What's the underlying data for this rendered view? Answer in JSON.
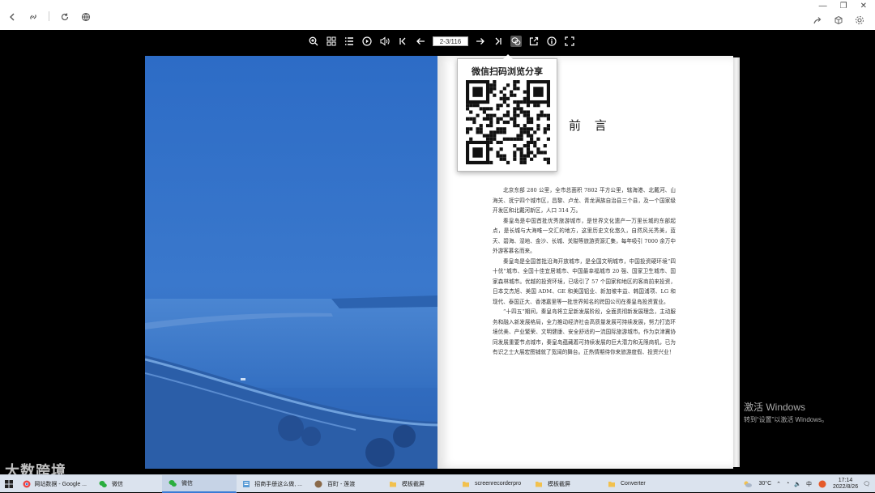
{
  "toolbar": {
    "page_indicator": "2-3/116"
  },
  "qr_popup": {
    "title": "微信扫码浏览分享"
  },
  "book": {
    "right_page": {
      "title": "前 言",
      "paragraphs": [
        "北京东部 280 公里，全市总面积 7802 平方公里，辖海港、北戴河、山海关、抚宁四个城市区，昌黎、卢龙、青龙满族自治县三个县，及一个国家级开发区和北戴河新区，人口 314 万。",
        "秦皇岛是中国首批优秀旅游城市，是世界文化遗产一万里长城的东部起点，是长城与大海唯一交汇的地方，这里历史文化悠久，自然风光秀美，蓝天、碧海、湿地、金沙、长城、关隘等旅游资源汇集，每年吸引 7000 余万中外游客慕名而来。",
        "秦皇岛是全国首批沿海开放城市，是全国文明城市，中国投资硬环境“四十优”城市、全国十佳宜居城市、中国最幸福城市 20 强、国家卫生城市、国家森林城市。优越的投资环境，已吸引了 57 个国家和地区的客商前来投资，日本艾杰旭、美国 ADM、GE 和美国铝业、新加坡丰益、韩国浦项、LG 和现代、泰国正大、香港嘉里等一批世界知名的跨国公司在秦皇岛投资置业。",
        "“十四五”期间，秦皇岛将立足新发展阶段，全面贯彻新发展理念，主动服务和融入新发展格局，全力推动经济社会高质量发展可持续发展，努力打造环境优美、产业繁荣、文明健康、安全舒适的一流国际旅游城市。作为京津冀协同发展重要节点城市，秦皇岛蕴藏着可持续发展的巨大潜力和无限商机，已为有识之士大展宏图铺就了宽阔的舞台。正热情期待你来旅游度假、投资兴业！"
      ]
    }
  },
  "watermark": {
    "line1": "激活 Windows",
    "line2": "转到“设置”以激活 Windows。",
    "logo": "大数跨境"
  },
  "taskbar": {
    "items": [
      {
        "label": "网站数据 - Google ..."
      },
      {
        "label": "微信"
      },
      {
        "label": "微信"
      },
      {
        "label": "招商手册这么做, ..."
      },
      {
        "label": "百町 - 莲渡"
      },
      {
        "label": "模板截屏"
      },
      {
        "label": "screenrecorderpro"
      },
      {
        "label": "模板截屏"
      },
      {
        "label": "Converter"
      }
    ],
    "temperature": "30°C",
    "ime": "中",
    "time": "17:14",
    "date": "2022/8/26"
  }
}
